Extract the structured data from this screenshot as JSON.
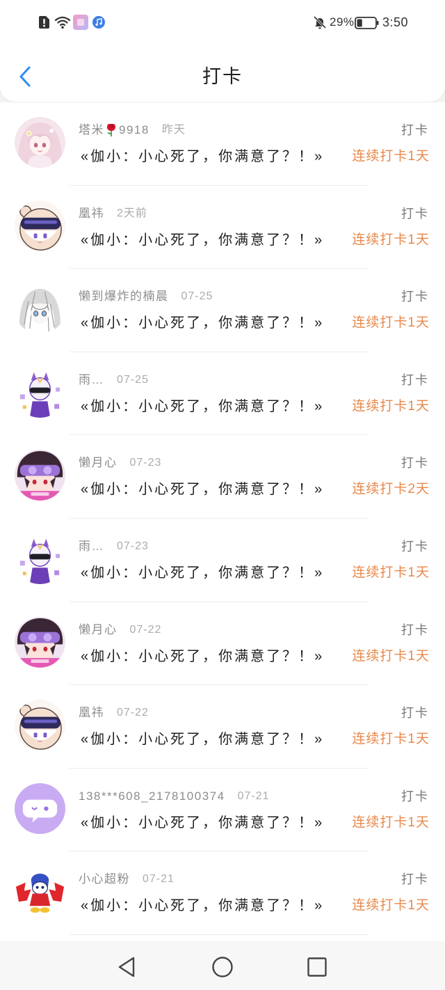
{
  "status_bar": {
    "left_icons": [
      "alert-icon",
      "wifi-icon",
      "app-icon",
      "music-icon"
    ],
    "notification_icon": "bell-off-icon",
    "battery_text": "29%",
    "battery_level": 0.29,
    "battery_icon": "battery-icon",
    "time": "3:50"
  },
  "header": {
    "back_icon": "chevron-left-icon",
    "title": "打卡"
  },
  "colors": {
    "accent": "#2b8ef0",
    "streak": "#e8884a",
    "name": "#8c8c8c",
    "date": "#ababab",
    "label": "#7a7a7a",
    "content": "#1f1f1f"
  },
  "list": {
    "items": [
      {
        "avatar": "pink-anime-avatar",
        "name": "塔米",
        "name_icon": "rose-icon",
        "name_suffix": "9918",
        "date": "昨天",
        "label": "打卡",
        "content": "«伽小：小心死了，你满意了？！»",
        "streak": "连续打卡1天"
      },
      {
        "avatar": "vr-cartoon-avatar",
        "name": "凰祎",
        "date": "2天前",
        "label": "打卡",
        "content": "«伽小：小心死了，你满意了？！»",
        "streak": "连续打卡1天"
      },
      {
        "avatar": "grayscale-girl-avatar",
        "name": "懒到爆炸的楠晨",
        "date": "07-25",
        "label": "打卡",
        "content": "«伽小：小心死了，你满意了？！»",
        "streak": "连续打卡1天"
      },
      {
        "avatar": "purple-hero-avatar",
        "name": "雨…",
        "date": "07-25",
        "label": "打卡",
        "content": "«伽小：小心死了，你满意了？！»",
        "streak": "连续打卡1天"
      },
      {
        "avatar": "goggles-boy-avatar",
        "name": "懒月心",
        "date": "07-23",
        "label": "打卡",
        "content": "«伽小：小心死了，你满意了？！»",
        "streak": "连续打卡2天"
      },
      {
        "avatar": "purple-hero-avatar",
        "name": "雨…",
        "date": "07-23",
        "label": "打卡",
        "content": "«伽小：小心死了，你满意了？！»",
        "streak": "连续打卡1天"
      },
      {
        "avatar": "goggles-boy-avatar",
        "name": "懒月心",
        "date": "07-22",
        "label": "打卡",
        "content": "«伽小：小心死了，你满意了？！»",
        "streak": "连续打卡1天"
      },
      {
        "avatar": "vr-cartoon-avatar",
        "name": "凰祎",
        "date": "07-22",
        "label": "打卡",
        "content": "«伽小：小心死了，你满意了？！»",
        "streak": "连续打卡1天"
      },
      {
        "avatar": "chat-bubble-avatar",
        "name": "138***608_2178100374",
        "date": "07-21",
        "label": "打卡",
        "content": "«伽小：小心死了，你满意了？！»",
        "streak": "连续打卡1天"
      },
      {
        "avatar": "red-cartoon-avatar",
        "name": "小心超粉",
        "date": "07-21",
        "label": "打卡",
        "content": "«伽小：小心死了，你满意了？！»",
        "streak": "连续打卡1天"
      }
    ]
  },
  "nav_bar": {
    "back_icon": "back-triangle-icon",
    "home_icon": "home-circle-icon",
    "recents_icon": "recents-square-icon"
  }
}
